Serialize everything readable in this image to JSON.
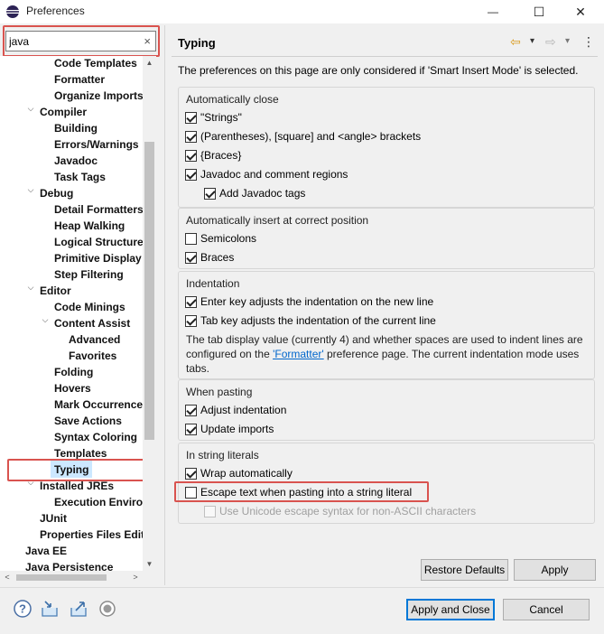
{
  "window": {
    "title": "Preferences",
    "minimize_glyph": "—",
    "maximize_glyph": "☐",
    "close_glyph": "✕"
  },
  "search": {
    "value": "java",
    "clear_glyph": "×"
  },
  "tree": {
    "items": [
      {
        "label": "Code Templates",
        "bold": true
      },
      {
        "label": "Formatter",
        "bold": true
      },
      {
        "label": "Organize Imports",
        "bold": true
      },
      {
        "label": "Compiler",
        "bold": true,
        "expanded": true
      },
      {
        "label": "Building",
        "bold": true
      },
      {
        "label": "Errors/Warnings",
        "bold": true
      },
      {
        "label": "Javadoc",
        "bold": true
      },
      {
        "label": "Task Tags",
        "bold": true
      },
      {
        "label": "Debug",
        "bold": true,
        "expanded": true
      },
      {
        "label": "Detail Formatters",
        "bold": true
      },
      {
        "label": "Heap Walking",
        "bold": true
      },
      {
        "label": "Logical Structures",
        "bold": true
      },
      {
        "label": "Primitive Display",
        "bold": true
      },
      {
        "label": "Step Filtering",
        "bold": true
      },
      {
        "label": "Editor",
        "bold": true,
        "expanded": true
      },
      {
        "label": "Code Minings",
        "bold": true
      },
      {
        "label": "Content Assist",
        "bold": true,
        "expanded": true
      },
      {
        "label": "Advanced",
        "bold": true
      },
      {
        "label": "Favorites",
        "bold": true
      },
      {
        "label": "Folding",
        "bold": true
      },
      {
        "label": "Hovers",
        "bold": true
      },
      {
        "label": "Mark Occurrences",
        "bold": true
      },
      {
        "label": "Save Actions",
        "bold": true
      },
      {
        "label": "Syntax Coloring",
        "bold": true
      },
      {
        "label": "Templates",
        "bold": true
      },
      {
        "label": "Typing",
        "bold": true,
        "selected": true
      },
      {
        "label": "Installed JREs",
        "bold": true,
        "expanded": true
      },
      {
        "label": "Execution Environments",
        "bold": true
      },
      {
        "label": "JUnit",
        "bold": true
      },
      {
        "label": "Properties Files Editor",
        "bold": true
      },
      {
        "label": "Java EE",
        "bold": true
      },
      {
        "label": "Java Persistence",
        "bold": true
      }
    ],
    "expanded_glyph": "⌵",
    "scroll_up_glyph": "▲",
    "scroll_down_glyph": "▼",
    "scroll_left_glyph": "<",
    "scroll_right_glyph": ">"
  },
  "page": {
    "title": "Typing",
    "description": "The preferences on this page are only considered if 'Smart Insert Mode' is selected.",
    "nav": {
      "back_glyph": "⇦",
      "forward_glyph": "⇨",
      "dropdown_glyph": "▾",
      "menu_glyph": "⋮"
    },
    "groups": {
      "auto_close": {
        "title": "Automatically close",
        "options": [
          {
            "label": "\"Strings\"",
            "checked": true
          },
          {
            "label": "(Parentheses), [square] and <angle> brackets",
            "checked": true
          },
          {
            "label": "{Braces}",
            "checked": true
          },
          {
            "label": "Javadoc and comment regions",
            "checked": true
          },
          {
            "label": "Add Javadoc tags",
            "checked": true
          }
        ]
      },
      "auto_insert": {
        "title": "Automatically insert at correct position",
        "options": [
          {
            "label": "Semicolons",
            "checked": false
          },
          {
            "label": "Braces",
            "checked": true
          }
        ]
      },
      "indentation": {
        "title": "Indentation",
        "options": [
          {
            "label": "Enter key adjusts the indentation on the new line",
            "checked": true
          },
          {
            "label": "Tab key adjusts the indentation of the current line",
            "checked": true
          }
        ],
        "note_part1": "The tab display value (currently 4) and whether spaces are used to indent lines are configured on the ",
        "note_link": "'Formatter'",
        "note_part2": " preference page. The current indentation mode uses tabs."
      },
      "pasting": {
        "title": "When pasting",
        "options": [
          {
            "label": "Adjust indentation",
            "checked": true
          },
          {
            "label": "Update imports",
            "checked": true
          }
        ]
      },
      "string_literals": {
        "title": "In string literals",
        "options": [
          {
            "label": "Wrap automatically",
            "checked": true
          },
          {
            "label": "Escape text when pasting into a string literal",
            "checked": false
          },
          {
            "label": "Use Unicode escape syntax for non-ASCII characters",
            "checked": false,
            "disabled": true
          }
        ]
      }
    },
    "restore_defaults_label": "Restore Defaults",
    "apply_label": "Apply"
  },
  "footer": {
    "apply_close_label": "Apply and Close",
    "cancel_label": "Cancel",
    "help_glyph": "?"
  },
  "colors": {
    "highlight": "#d9534f",
    "selection": "#cce8ff",
    "link": "#0066cc",
    "primary_border": "#0078d7"
  }
}
